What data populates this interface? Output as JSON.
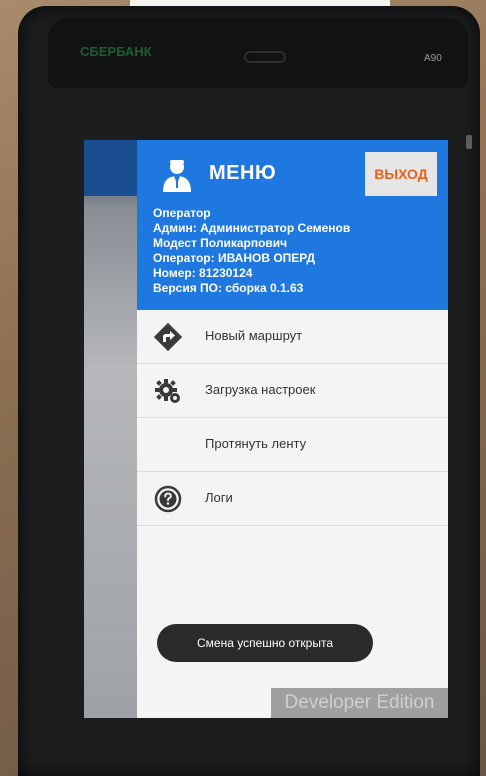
{
  "device": {
    "brand": "СБЕРБАНК",
    "model": "A90"
  },
  "header": {
    "title": "МЕНЮ",
    "exit_label": "ВЫХОД"
  },
  "operator_info": {
    "line1": "Оператор",
    "line2": "Админ: Администратор Семенов",
    "line3": "Модест Поликарпович",
    "line4": "Оператор: ИВАНОВ ОПЕРД",
    "line5": "Номер: 81230124",
    "line6": "Версия ПО: сборка 0.1.63"
  },
  "menu": {
    "items": [
      {
        "label": "Новый маршрут",
        "icon": "route-arrow-icon"
      },
      {
        "label": "Загрузка настроек",
        "icon": "gear-download-icon"
      },
      {
        "label": "Протянуть ленту",
        "icon": ""
      },
      {
        "label": "Логи",
        "icon": "help-circle-icon"
      }
    ]
  },
  "toast": {
    "message": "Смена успешно открыта"
  },
  "watermark": {
    "text": "Developer Edition"
  },
  "colors": {
    "header_blue": "#1f78e0",
    "exit_text": "#e8601c",
    "toast_bg": "#2b2b2b"
  }
}
